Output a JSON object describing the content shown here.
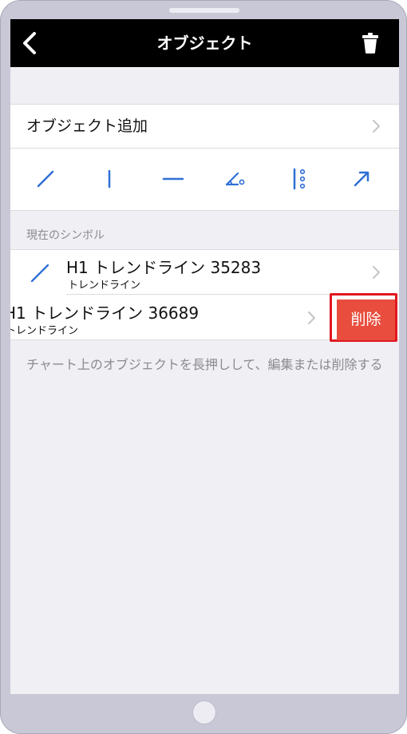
{
  "nav": {
    "title": "オブジェクト",
    "back_icon": "chevron-left-icon",
    "trash_icon": "trash-icon"
  },
  "add_object": {
    "label": "オブジェクト追加"
  },
  "tools": [
    {
      "name": "trendline-tool-icon"
    },
    {
      "name": "vertical-line-tool-icon"
    },
    {
      "name": "horizontal-line-tool-icon"
    },
    {
      "name": "angle-tool-icon"
    },
    {
      "name": "channel-tool-icon"
    },
    {
      "name": "arrow-tool-icon"
    }
  ],
  "section": {
    "header": "現在のシンボル"
  },
  "objects": [
    {
      "title": "H1 トレンドライン 35283",
      "subtitle": "トレンドライン"
    },
    {
      "title": "H1 トレンドライン 36689",
      "subtitle": "トレンドライン"
    }
  ],
  "delete": {
    "label": "削除"
  },
  "hint": "チャート上のオブジェクトを長押しして、編集または削除する",
  "colors": {
    "accent": "#2f6fd6",
    "delete": "#e84d3d",
    "highlight": "#e0171f",
    "navbar": "#000000",
    "background": "#efeff4"
  }
}
